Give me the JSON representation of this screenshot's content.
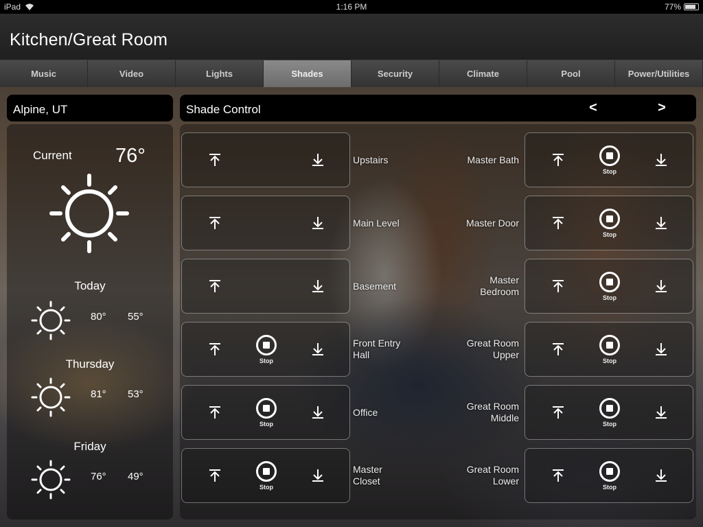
{
  "status_bar": {
    "device": "iPad",
    "time": "1:16 PM",
    "battery": "77%",
    "battery_level": 0.77
  },
  "room_title": "Kitchen/Great Room",
  "tabs": [
    {
      "label": "Music"
    },
    {
      "label": "Video"
    },
    {
      "label": "Lights"
    },
    {
      "label": "Shades",
      "active": true
    },
    {
      "label": "Security"
    },
    {
      "label": "Climate"
    },
    {
      "label": "Pool"
    },
    {
      "label": "Power/Utilities"
    }
  ],
  "weather": {
    "location": "Alpine, UT",
    "current_label": "Current",
    "current_temp": "76°",
    "forecast": [
      {
        "day": "Today",
        "high": "80°",
        "low": "55°",
        "icon": "sun-icon"
      },
      {
        "day": "Thursday",
        "high": "81°",
        "low": "53°",
        "icon": "sun-icon"
      },
      {
        "day": "Friday",
        "high": "76°",
        "low": "49°",
        "icon": "sun-icon"
      }
    ]
  },
  "shade_control": {
    "title": "Shade Control",
    "prev_label": "<",
    "next_label": ">",
    "stop_label": "Stop",
    "left_column": [
      {
        "name": "Upstairs",
        "has_stop": false
      },
      {
        "name": "Main Level",
        "has_stop": false
      },
      {
        "name": "Basement",
        "has_stop": false
      },
      {
        "name": "Front Entry\nHall",
        "has_stop": true
      },
      {
        "name": "Office",
        "has_stop": true
      },
      {
        "name": "Master\nCloset",
        "has_stop": true
      }
    ],
    "right_column": [
      {
        "name": "Master Bath",
        "has_stop": true
      },
      {
        "name": "Master Door",
        "has_stop": true
      },
      {
        "name": "Master\nBedroom",
        "has_stop": true
      },
      {
        "name": "Great Room\nUpper",
        "has_stop": true
      },
      {
        "name": "Great Room\nMiddle",
        "has_stop": true
      },
      {
        "name": "Great Room\nLower",
        "has_stop": true
      }
    ]
  },
  "colors": {
    "header_bg": "#000000",
    "tab_active": "#7a7a7a",
    "tab_bg": "#3e3e3e",
    "text": "#ffffff"
  }
}
